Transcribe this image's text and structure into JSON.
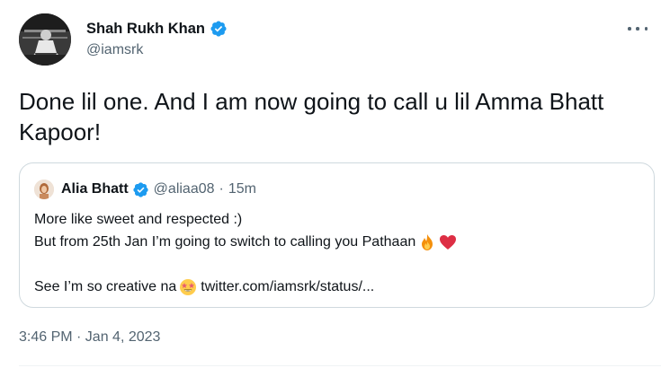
{
  "author": {
    "display_name": "Shah Rukh Khan",
    "handle": "@iamsrk",
    "verified": true
  },
  "more_icon": "more-horizontal-icon",
  "tweet": {
    "text": "Done lil one. And I am now going to call u lil Amma Bhatt Kapoor!"
  },
  "quoted_tweet": {
    "display_name": "Alia Bhatt",
    "handle": "@aliaa08",
    "separator": "·",
    "time": "15m",
    "line1": "More like sweet and respected :)",
    "line2": "But from 25th Jan I’m going to switch to calling you Pathaan",
    "line3": "See I’m so creative na",
    "link": "twitter.com/iamsrk/status/...",
    "emojis": [
      "fire-emoji",
      "red-heart-emoji",
      "star-struck-emoji"
    ]
  },
  "timestamp": "3:46 PM · Jan 4, 2023",
  "colors": {
    "verified_blue": "#1d9bf0",
    "secondary_text": "#536471",
    "border": "#cfd9de"
  }
}
